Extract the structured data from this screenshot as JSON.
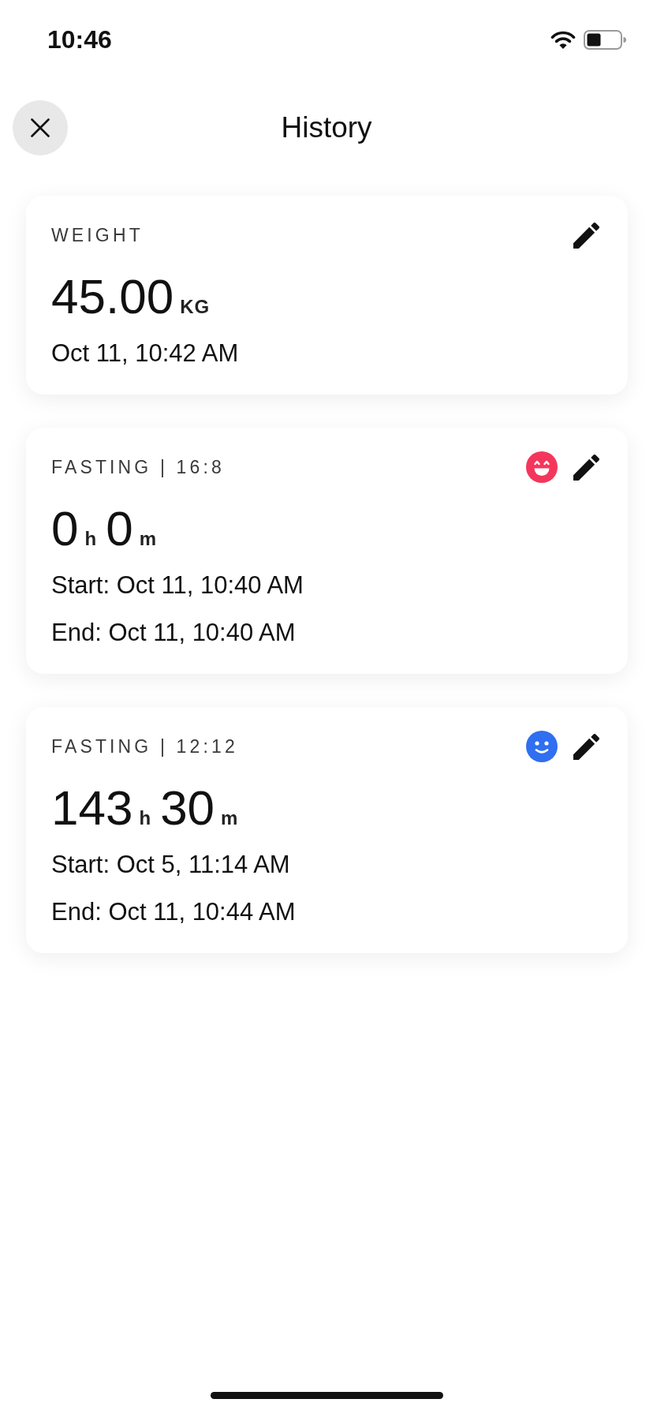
{
  "status_bar": {
    "time": "10:46"
  },
  "header": {
    "title": "History"
  },
  "entries": [
    {
      "kind": "weight",
      "label": "WEIGHT",
      "reading": [
        {
          "value": "45.00",
          "unit": "KG"
        }
      ],
      "lines": [
        "Oct 11, 10:42 AM"
      ]
    },
    {
      "kind": "fasting",
      "label": "FASTING | 16:8",
      "mood": {
        "kind": "grin",
        "color": "#f5365c"
      },
      "reading": [
        {
          "value": "0",
          "unit": "h"
        },
        {
          "value": "0",
          "unit": "m"
        }
      ],
      "lines": [
        "Start: Oct 11, 10:40 AM",
        "End: Oct 11, 10:40 AM"
      ]
    },
    {
      "kind": "fasting",
      "label": "FASTING | 12:12",
      "mood": {
        "kind": "smile",
        "color": "#2f6ff0"
      },
      "reading": [
        {
          "value": "143",
          "unit": "h"
        },
        {
          "value": "30",
          "unit": "m"
        }
      ],
      "lines": [
        "Start: Oct 5, 11:14 AM",
        "End: Oct 11, 10:44 AM"
      ]
    }
  ]
}
